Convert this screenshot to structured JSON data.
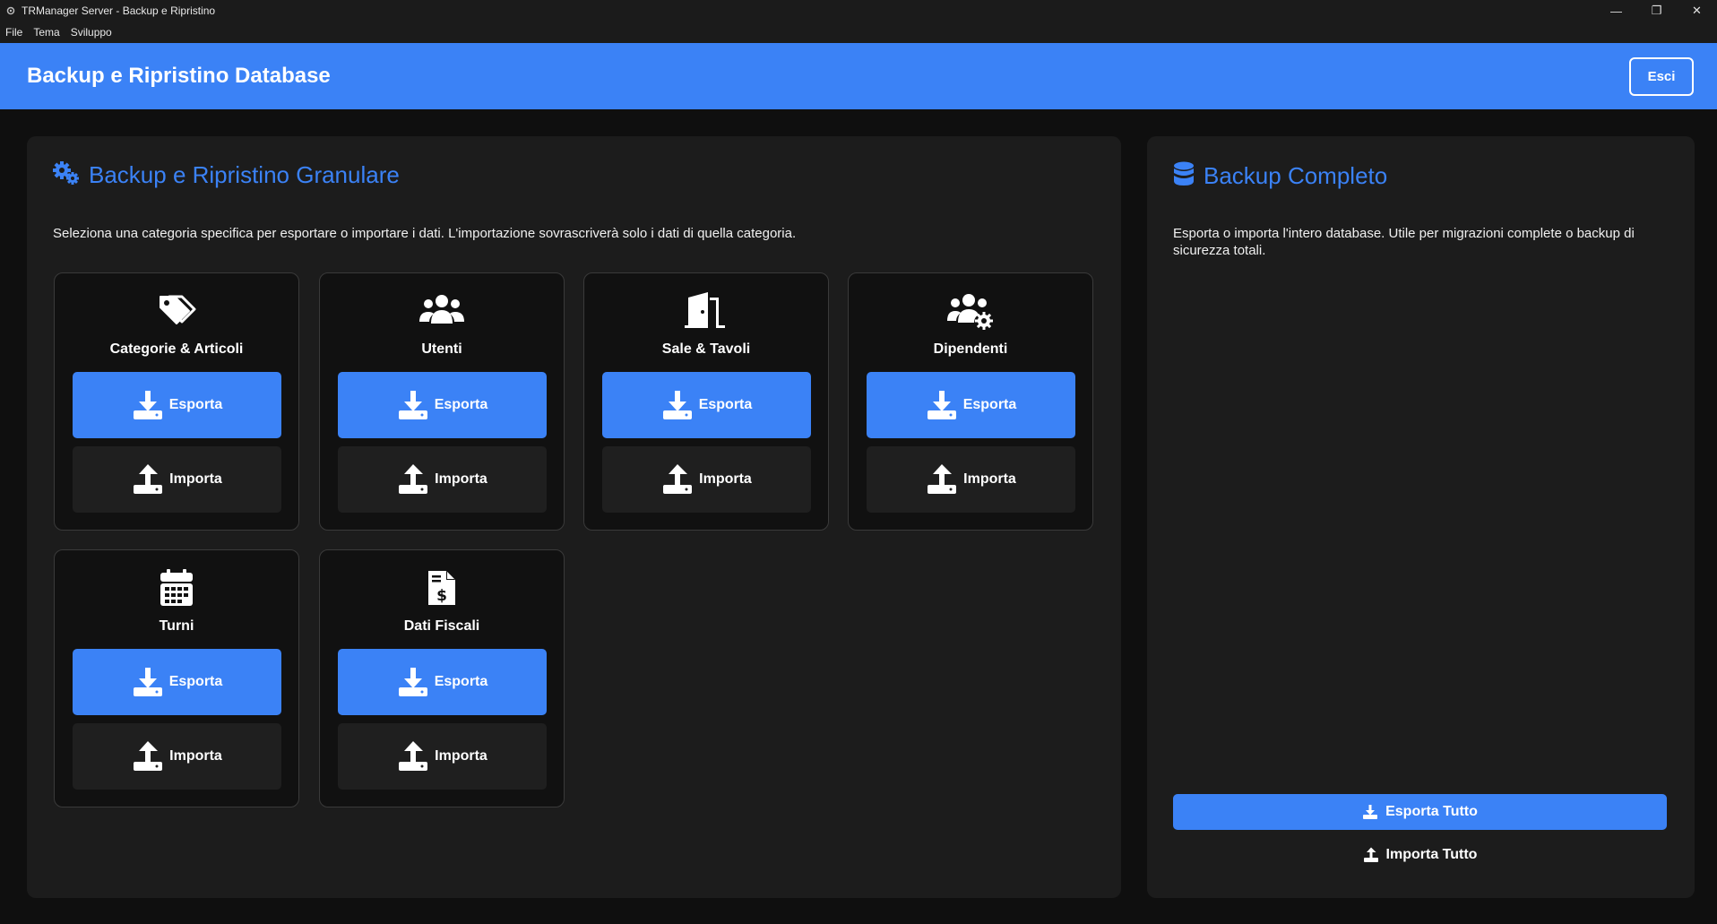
{
  "window": {
    "title": "TRManager Server - Backup e Ripristino",
    "minimize": "—",
    "maximize": "❐",
    "close": "✕"
  },
  "menu": [
    "File",
    "Tema",
    "Sviluppo"
  ],
  "header": {
    "title": "Backup e Ripristino Database",
    "exit_label": "Esci"
  },
  "granular": {
    "title": "Backup e Ripristino Granulare",
    "description": "Seleziona una categoria specifica per esportare o importare i dati. L'importazione sovrascriverà solo i dati di quella categoria.",
    "categories": [
      {
        "label": "Categorie & Articoli",
        "icon": "tags-icon",
        "export_label": "Esporta",
        "import_label": "Importa"
      },
      {
        "label": "Utenti",
        "icon": "users-icon",
        "export_label": "Esporta",
        "import_label": "Importa"
      },
      {
        "label": "Sale & Tavoli",
        "icon": "door-icon",
        "export_label": "Esporta",
        "import_label": "Importa"
      },
      {
        "label": "Dipendenti",
        "icon": "users-gear-icon",
        "export_label": "Esporta",
        "import_label": "Importa"
      },
      {
        "label": "Turni",
        "icon": "calendar-icon",
        "export_label": "Esporta",
        "import_label": "Importa"
      },
      {
        "label": "Dati Fiscali",
        "icon": "invoice-dollar-icon",
        "export_label": "Esporta",
        "import_label": "Importa"
      }
    ]
  },
  "full": {
    "title": "Backup Completo",
    "description": "Esporta o importa l'intero database. Utile per migrazioni complete o backup di sicurezza totali.",
    "export_all_label": "Esporta Tutto",
    "import_all_label": "Importa Tutto"
  },
  "colors": {
    "accent": "#3b82f6",
    "background": "#0f0f0f",
    "panel": "#1c1c1c",
    "card": "#111111"
  }
}
